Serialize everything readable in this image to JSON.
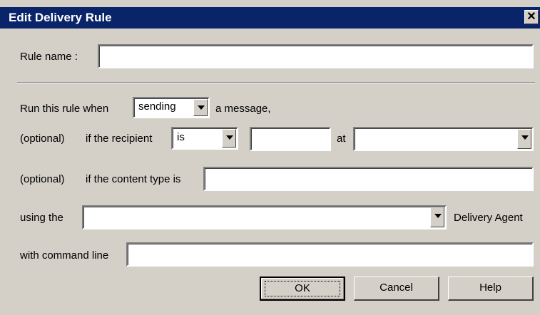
{
  "window": {
    "title": "Edit Delivery Rule",
    "close_glyph": "✕"
  },
  "rule_name": {
    "label": "Rule name :",
    "value": ""
  },
  "run_when": {
    "label": "Run this rule when",
    "selected": "sending",
    "suffix": "a message,"
  },
  "recipient": {
    "optional_label": "(optional)",
    "label": "if the recipient",
    "operator_selected": "is",
    "name_value": "",
    "at_label": "at",
    "domain_selected": ""
  },
  "content_type": {
    "optional_label": "(optional)",
    "label": "if the content type is",
    "value": ""
  },
  "agent": {
    "label": "using the",
    "selected": "",
    "suffix": "Delivery Agent"
  },
  "command_line": {
    "label": "with command line",
    "value": ""
  },
  "buttons": {
    "ok": "OK",
    "cancel": "Cancel",
    "help": "Help"
  },
  "icons": {
    "close": "close-icon",
    "dropdown": "chevron-down-icon"
  },
  "colors": {
    "titlebar": "#0a246a",
    "dialog_bg": "#d4d0c8"
  }
}
